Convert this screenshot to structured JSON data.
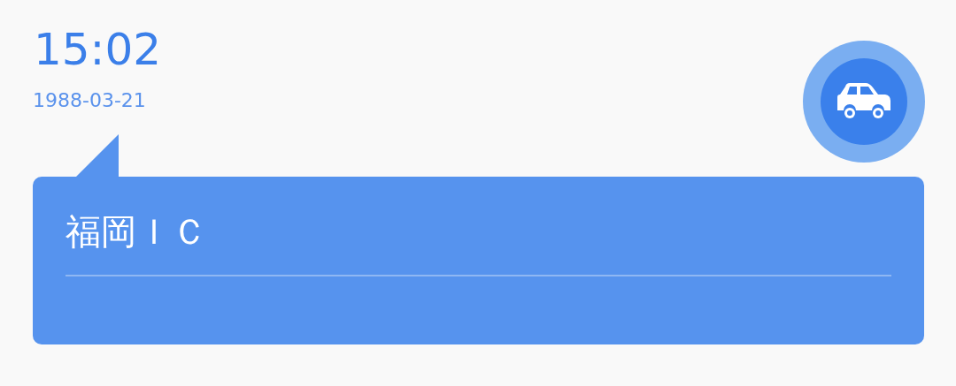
{
  "time": "15:02",
  "date": "1988-03-21",
  "card": {
    "title": "福岡ＩＣ"
  }
}
